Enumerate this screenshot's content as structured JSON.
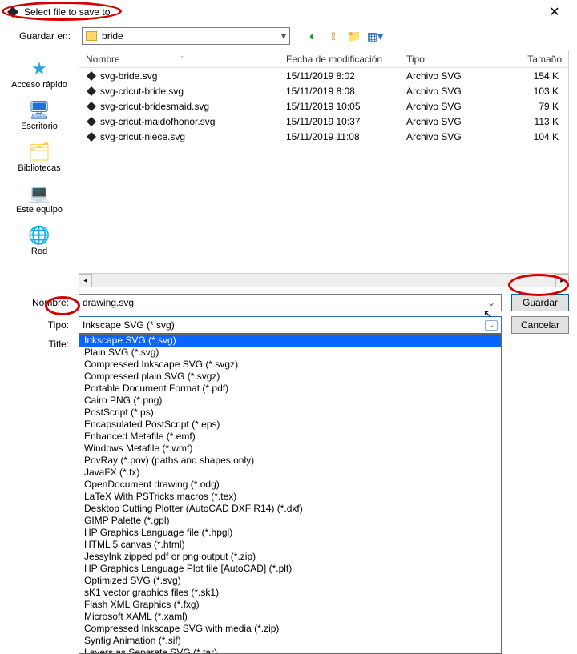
{
  "title": "Select file to save to",
  "look_in_label": "Guardar en:",
  "look_in_folder": "bride",
  "sidebar": [
    {
      "label": "Acceso rápido",
      "icon_color": "#2aa8e0"
    },
    {
      "label": "Escritorio",
      "icon_color": "#1e6fd8"
    },
    {
      "label": "Bibliotecas",
      "icon_color": "#ffcf3e"
    },
    {
      "label": "Este equipo",
      "icon_color": "#1e6fd8"
    },
    {
      "label": "Red",
      "icon_color": "#2aa8e0"
    }
  ],
  "columns": {
    "name": "Nombre",
    "date": "Fecha de modificación",
    "type": "Tipo",
    "size": "Tamaño"
  },
  "files": [
    {
      "name": "svg-bride.svg",
      "date": "15/11/2019 8:02",
      "type": "Archivo SVG",
      "size": "154 K"
    },
    {
      "name": "svg-cricut-bride.svg",
      "date": "15/11/2019 8:08",
      "type": "Archivo SVG",
      "size": "103 K"
    },
    {
      "name": "svg-cricut-bridesmaid.svg",
      "date": "15/11/2019 10:05",
      "type": "Archivo SVG",
      "size": "79 K"
    },
    {
      "name": "svg-cricut-maidofhonor.svg",
      "date": "15/11/2019 10:37",
      "type": "Archivo SVG",
      "size": "113 K"
    },
    {
      "name": "svg-cricut-niece.svg",
      "date": "15/11/2019 11:08",
      "type": "Archivo SVG",
      "size": "104 K"
    }
  ],
  "form": {
    "name_label": "Nombre:",
    "name_value": "drawing.svg",
    "type_label": "Tipo:",
    "type_current": "Inkscape SVG (*.svg)",
    "title_label": "Title:",
    "save_btn": "Guardar",
    "cancel_btn": "Cancelar"
  },
  "file_types": [
    {
      "label": "Inkscape SVG (*.svg)",
      "selected": true
    },
    {
      "label": "Plain SVG (*.svg)"
    },
    {
      "label": "Compressed Inkscape SVG (*.svgz)"
    },
    {
      "label": "Compressed plain SVG (*.svgz)"
    },
    {
      "label": "Portable Document Format (*.pdf)"
    },
    {
      "label": "Cairo PNG (*.png)"
    },
    {
      "label": "PostScript (*.ps)"
    },
    {
      "label": "Encapsulated PostScript (*.eps)"
    },
    {
      "label": "Enhanced Metafile (*.emf)"
    },
    {
      "label": "Windows Metafile (*.wmf)"
    },
    {
      "label": "PovRay (*.pov) (paths and shapes only)"
    },
    {
      "label": "JavaFX (*.fx)"
    },
    {
      "label": "OpenDocument drawing (*.odg)"
    },
    {
      "label": "LaTeX With PSTricks macros (*.tex)"
    },
    {
      "label": "Desktop Cutting Plotter (AutoCAD DXF R14) (*.dxf)"
    },
    {
      "label": "GIMP Palette (*.gpl)"
    },
    {
      "label": "HP Graphics Language file (*.hpgl)"
    },
    {
      "label": "HTML 5 canvas (*.html)"
    },
    {
      "label": "JessyInk zipped pdf or png output (*.zip)"
    },
    {
      "label": "HP Graphics Language Plot file [AutoCAD] (*.plt)"
    },
    {
      "label": "Optimized SVG (*.svg)"
    },
    {
      "label": "sK1 vector graphics files (*.sk1)"
    },
    {
      "label": "Flash XML Graphics (*.fxg)"
    },
    {
      "label": "Microsoft XAML (*.xaml)"
    },
    {
      "label": "Compressed Inkscape SVG with media (*.zip)"
    },
    {
      "label": "Synfig Animation (*.sif)"
    },
    {
      "label": "Layers as Separate SVG (*.tar)"
    }
  ]
}
